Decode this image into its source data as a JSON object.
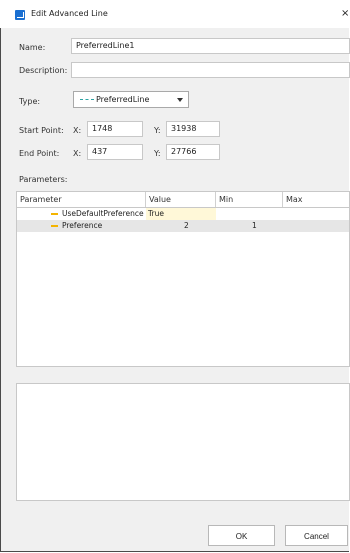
{
  "window": {
    "title": "Edit Advanced Line",
    "close_glyph": "×"
  },
  "form": {
    "name_label": "Name:",
    "name_value": "PreferredLine1",
    "description_label": "Description:",
    "description_value": "",
    "type_label": "Type:",
    "type_value": "PreferredLine",
    "start_label": "Start Point:",
    "start_x_label": "X:",
    "start_x": "1748",
    "start_y_label": "Y:",
    "start_y": "31938",
    "end_label": "End Point:",
    "end_x_label": "X:",
    "end_x": "437",
    "end_y_label": "Y:",
    "end_y": "27766",
    "parameters_label": "Parameters:"
  },
  "grid": {
    "columns": [
      "Parameter",
      "Value",
      "Min",
      "Max"
    ],
    "rows": [
      {
        "parameter": "UseDefaultPreference",
        "value": "True",
        "min": "",
        "max": ""
      },
      {
        "parameter": "Preference",
        "value": "2",
        "min": "1",
        "max": ""
      }
    ]
  },
  "buttons": {
    "ok": "OK",
    "cancel": "Cancel"
  },
  "colors": {
    "accent": "#1a6fd1",
    "param_marker": "#f4b400",
    "line_dash": "#2aa3a3"
  }
}
